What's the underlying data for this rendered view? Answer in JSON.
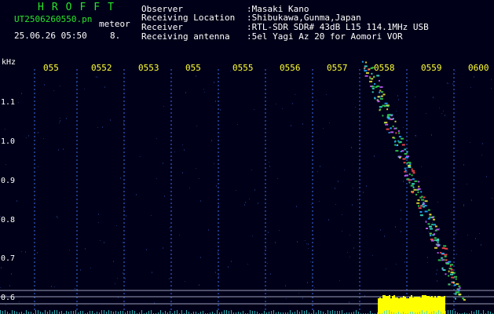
{
  "header": {
    "title": "HROFFT",
    "filename": "UT2506260550.pn",
    "type": "meteor",
    "datetime": "25.06.26 05:50",
    "count": "8."
  },
  "info": {
    "observer_label": "Observer",
    "observer_value": ":Masaki Kano",
    "location_label": "Receiving Location",
    "location_value": ":Shibukawa,Gunma,Japan",
    "receiver_label": "Receiver",
    "receiver_value": ":RTL-SDR SDR# 43dB L15 114.1MHz USB",
    "antenna_label": "Receiving antenna",
    "antenna_value": ":5el Yagi Az 20 for Aomori VOR"
  },
  "axis": {
    "unit": "kHz",
    "y_labels": [
      "1.1",
      "1.0",
      "0.9",
      "0.8",
      "0.7",
      "0.6"
    ],
    "x_labels": [
      "055",
      "0552",
      "0553",
      "055",
      "0555",
      "0556",
      "0557",
      "0558",
      "0559",
      "0600"
    ]
  },
  "colors": {
    "background": "#000018",
    "header_green": "#29e629",
    "text_white": "#ffffff",
    "time_yellow": "#ffff33",
    "gridline_blue": "#2a4aa8",
    "echo_trail": "#2fd04f",
    "signal_bar": "#ffff00"
  }
}
